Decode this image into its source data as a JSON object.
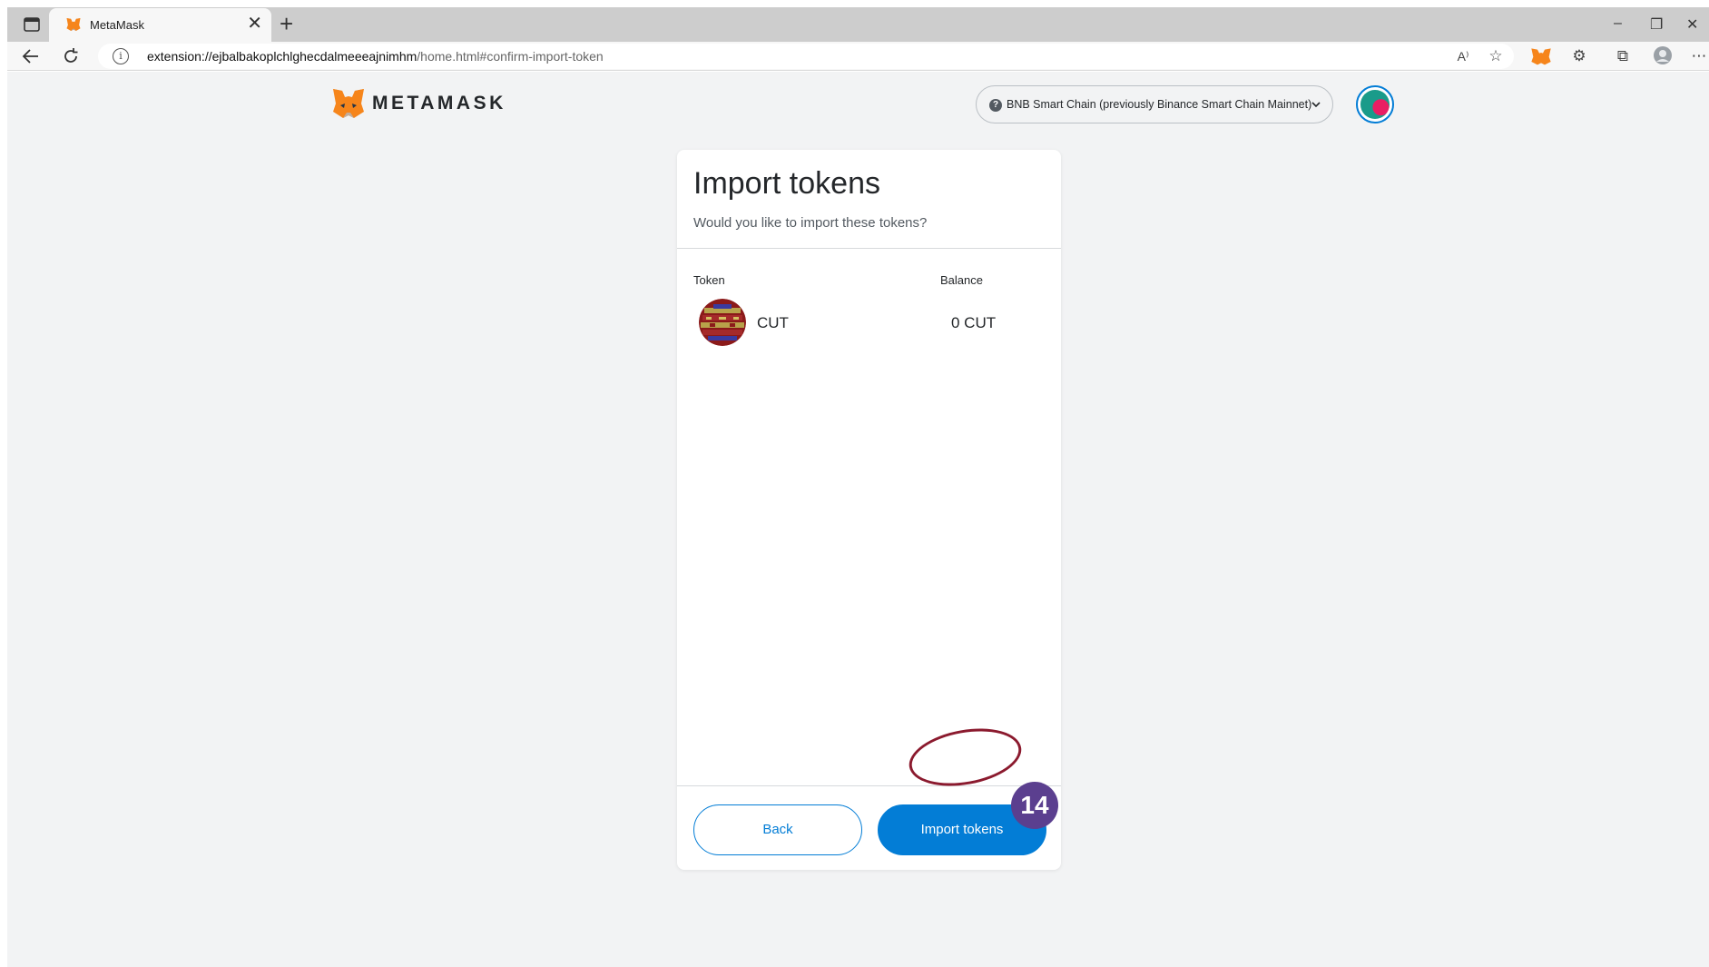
{
  "browser": {
    "tab_title": "MetaMask",
    "tab_close": "✕",
    "new_tab": "+",
    "window_controls": {
      "minimize": "–",
      "restore": "❐",
      "close": "✕"
    },
    "url_host": "extension://ejbalbakoplchlghecdalmeeeajnimhm",
    "url_path": "/home.html#confirm-import-token",
    "icons": [
      "sidebar-toggle-icon",
      "back-arrow-icon",
      "reload-icon",
      "info-icon",
      "read-aloud-icon",
      "favorite-icon",
      "metamask-extension-icon",
      "extensions-icon",
      "collections-icon",
      "profile-icon",
      "more-icon"
    ]
  },
  "header": {
    "wordmark": "METAMASK",
    "network_label": "BNB Smart Chain (previously Binance Smart Chain Mainnet)",
    "network_badge": "?"
  },
  "card": {
    "title": "Import tokens",
    "subtitle": "Would you like to import these tokens?",
    "col_token": "Token",
    "col_balance": "Balance",
    "tokens": [
      {
        "symbol": "CUT",
        "balance": "0 CUT"
      }
    ],
    "back_label": "Back",
    "import_label": "Import tokens"
  },
  "annotation": {
    "step_number": "14",
    "color": "#5b3f8f"
  },
  "colors": {
    "primary": "#037dd6",
    "page_bg": "#f2f3f4"
  }
}
